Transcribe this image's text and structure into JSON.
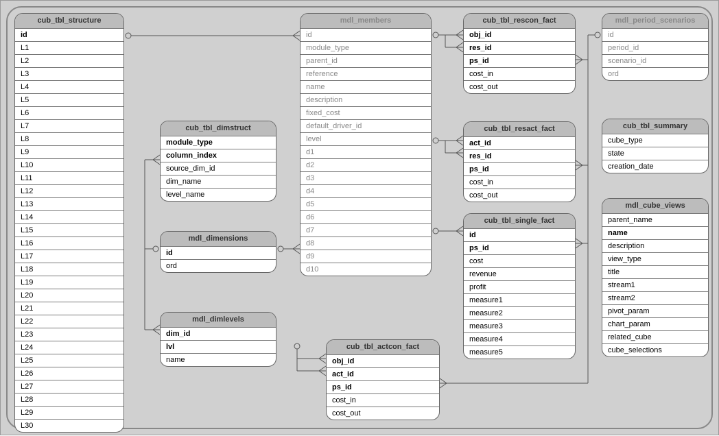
{
  "entities": {
    "structure": {
      "title": "cub_tbl_structure",
      "cols": [
        {
          "n": "id",
          "b": true
        },
        {
          "n": "L1"
        },
        {
          "n": "L2"
        },
        {
          "n": "L3"
        },
        {
          "n": "L4"
        },
        {
          "n": "L5"
        },
        {
          "n": "L6"
        },
        {
          "n": "L7"
        },
        {
          "n": "L8"
        },
        {
          "n": "L9"
        },
        {
          "n": "L10"
        },
        {
          "n": "L11"
        },
        {
          "n": "L12"
        },
        {
          "n": "L13"
        },
        {
          "n": "L14"
        },
        {
          "n": "L15"
        },
        {
          "n": "L16"
        },
        {
          "n": "L17"
        },
        {
          "n": "L18"
        },
        {
          "n": "L19"
        },
        {
          "n": "L20"
        },
        {
          "n": "L21"
        },
        {
          "n": "L22"
        },
        {
          "n": "L23"
        },
        {
          "n": "L24"
        },
        {
          "n": "L25"
        },
        {
          "n": "L26"
        },
        {
          "n": "L27"
        },
        {
          "n": "L28"
        },
        {
          "n": "L29"
        },
        {
          "n": "L30"
        }
      ]
    },
    "dimstruct": {
      "title": "cub_tbl_dimstruct",
      "cols": [
        {
          "n": "module_type",
          "b": true
        },
        {
          "n": "column_index",
          "b": true
        },
        {
          "n": "source_dim_id"
        },
        {
          "n": "dim_name"
        },
        {
          "n": "level_name"
        }
      ]
    },
    "dimensions": {
      "title": "mdl_dimensions",
      "cols": [
        {
          "n": "id",
          "b": true
        },
        {
          "n": "ord"
        }
      ]
    },
    "dimlevels": {
      "title": "mdl_dimlevels",
      "cols": [
        {
          "n": "dim_id",
          "b": true
        },
        {
          "n": "lvl",
          "b": true
        },
        {
          "n": "name"
        }
      ]
    },
    "members": {
      "title": "mdl_members",
      "cols": [
        {
          "n": "id",
          "f": true
        },
        {
          "n": "module_type",
          "f": true
        },
        {
          "n": "parent_id",
          "f": true
        },
        {
          "n": "reference",
          "f": true
        },
        {
          "n": "name",
          "f": true
        },
        {
          "n": "description",
          "f": true
        },
        {
          "n": "fixed_cost",
          "f": true
        },
        {
          "n": "default_driver_id",
          "f": true
        },
        {
          "n": "level",
          "f": true
        },
        {
          "n": "d1",
          "f": true
        },
        {
          "n": "d2",
          "f": true
        },
        {
          "n": "d3",
          "f": true
        },
        {
          "n": "d4",
          "f": true
        },
        {
          "n": "d5",
          "f": true
        },
        {
          "n": "d6",
          "f": true
        },
        {
          "n": "d7",
          "f": true
        },
        {
          "n": "d8",
          "f": true
        },
        {
          "n": "d9",
          "f": true
        },
        {
          "n": "d10",
          "f": true
        }
      ]
    },
    "actcon": {
      "title": "cub_tbl_actcon_fact",
      "cols": [
        {
          "n": "obj_id",
          "b": true
        },
        {
          "n": "act_id",
          "b": true
        },
        {
          "n": "ps_id",
          "b": true
        },
        {
          "n": "cost_in"
        },
        {
          "n": "cost_out"
        }
      ]
    },
    "rescon": {
      "title": "cub_tbl_rescon_fact",
      "cols": [
        {
          "n": "obj_id",
          "b": true
        },
        {
          "n": "res_id",
          "b": true
        },
        {
          "n": "ps_id",
          "b": true
        },
        {
          "n": "cost_in"
        },
        {
          "n": "cost_out"
        }
      ]
    },
    "resact": {
      "title": "cub_tbl_resact_fact",
      "cols": [
        {
          "n": "act_id",
          "b": true
        },
        {
          "n": "res_id",
          "b": true
        },
        {
          "n": "ps_id",
          "b": true
        },
        {
          "n": "cost_in"
        },
        {
          "n": "cost_out"
        }
      ]
    },
    "single": {
      "title": "cub_tbl_single_fact",
      "cols": [
        {
          "n": "id",
          "b": true
        },
        {
          "n": "ps_id",
          "b": true
        },
        {
          "n": "cost"
        },
        {
          "n": "revenue"
        },
        {
          "n": "profit"
        },
        {
          "n": "measure1"
        },
        {
          "n": "measure2"
        },
        {
          "n": "measure3"
        },
        {
          "n": "measure4"
        },
        {
          "n": "measure5"
        }
      ]
    },
    "period": {
      "title": "mdl_period_scenarios",
      "cols": [
        {
          "n": "id",
          "f": true
        },
        {
          "n": "period_id",
          "f": true
        },
        {
          "n": "scenario_id",
          "f": true
        },
        {
          "n": "ord",
          "f": true
        }
      ]
    },
    "summary": {
      "title": "cub_tbl_summary",
      "cols": [
        {
          "n": "cube_type"
        },
        {
          "n": "state"
        },
        {
          "n": "creation_date"
        }
      ]
    },
    "views": {
      "title": "mdl_cube_views",
      "cols": [
        {
          "n": "parent_name"
        },
        {
          "n": "name",
          "b": true
        },
        {
          "n": "description"
        },
        {
          "n": "view_type"
        },
        {
          "n": "title"
        },
        {
          "n": "stream1"
        },
        {
          "n": "stream2"
        },
        {
          "n": "pivot_param"
        },
        {
          "n": "chart_param"
        },
        {
          "n": "related_cube"
        },
        {
          "n": "cube_selections"
        }
      ]
    }
  }
}
